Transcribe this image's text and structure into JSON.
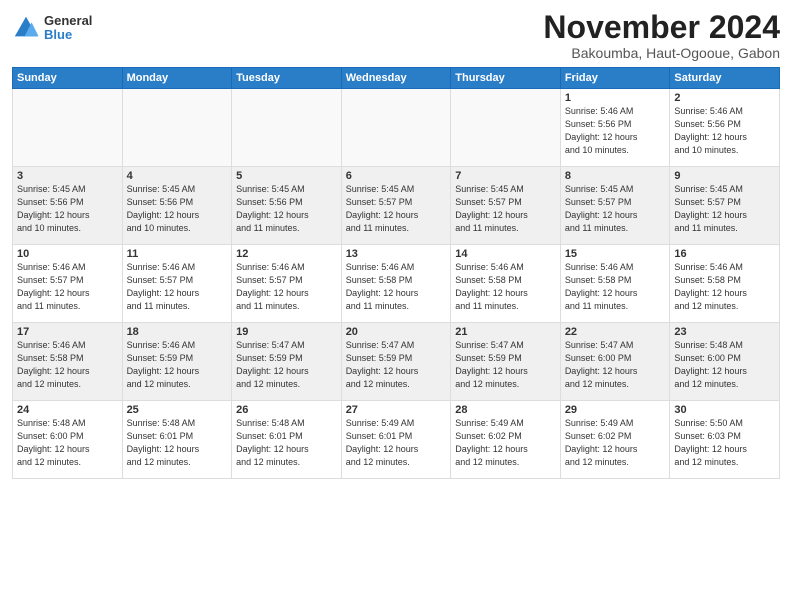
{
  "logo": {
    "general": "General",
    "blue": "Blue"
  },
  "header": {
    "month": "November 2024",
    "location": "Bakoumba, Haut-Ogooue, Gabon"
  },
  "days_of_week": [
    "Sunday",
    "Monday",
    "Tuesday",
    "Wednesday",
    "Thursday",
    "Friday",
    "Saturday"
  ],
  "weeks": [
    [
      {
        "day": "",
        "info": ""
      },
      {
        "day": "",
        "info": ""
      },
      {
        "day": "",
        "info": ""
      },
      {
        "day": "",
        "info": ""
      },
      {
        "day": "",
        "info": ""
      },
      {
        "day": "1",
        "info": "Sunrise: 5:46 AM\nSunset: 5:56 PM\nDaylight: 12 hours\nand 10 minutes."
      },
      {
        "day": "2",
        "info": "Sunrise: 5:46 AM\nSunset: 5:56 PM\nDaylight: 12 hours\nand 10 minutes."
      }
    ],
    [
      {
        "day": "3",
        "info": "Sunrise: 5:45 AM\nSunset: 5:56 PM\nDaylight: 12 hours\nand 10 minutes."
      },
      {
        "day": "4",
        "info": "Sunrise: 5:45 AM\nSunset: 5:56 PM\nDaylight: 12 hours\nand 10 minutes."
      },
      {
        "day": "5",
        "info": "Sunrise: 5:45 AM\nSunset: 5:56 PM\nDaylight: 12 hours\nand 11 minutes."
      },
      {
        "day": "6",
        "info": "Sunrise: 5:45 AM\nSunset: 5:57 PM\nDaylight: 12 hours\nand 11 minutes."
      },
      {
        "day": "7",
        "info": "Sunrise: 5:45 AM\nSunset: 5:57 PM\nDaylight: 12 hours\nand 11 minutes."
      },
      {
        "day": "8",
        "info": "Sunrise: 5:45 AM\nSunset: 5:57 PM\nDaylight: 12 hours\nand 11 minutes."
      },
      {
        "day": "9",
        "info": "Sunrise: 5:45 AM\nSunset: 5:57 PM\nDaylight: 12 hours\nand 11 minutes."
      }
    ],
    [
      {
        "day": "10",
        "info": "Sunrise: 5:46 AM\nSunset: 5:57 PM\nDaylight: 12 hours\nand 11 minutes."
      },
      {
        "day": "11",
        "info": "Sunrise: 5:46 AM\nSunset: 5:57 PM\nDaylight: 12 hours\nand 11 minutes."
      },
      {
        "day": "12",
        "info": "Sunrise: 5:46 AM\nSunset: 5:57 PM\nDaylight: 12 hours\nand 11 minutes."
      },
      {
        "day": "13",
        "info": "Sunrise: 5:46 AM\nSunset: 5:58 PM\nDaylight: 12 hours\nand 11 minutes."
      },
      {
        "day": "14",
        "info": "Sunrise: 5:46 AM\nSunset: 5:58 PM\nDaylight: 12 hours\nand 11 minutes."
      },
      {
        "day": "15",
        "info": "Sunrise: 5:46 AM\nSunset: 5:58 PM\nDaylight: 12 hours\nand 11 minutes."
      },
      {
        "day": "16",
        "info": "Sunrise: 5:46 AM\nSunset: 5:58 PM\nDaylight: 12 hours\nand 12 minutes."
      }
    ],
    [
      {
        "day": "17",
        "info": "Sunrise: 5:46 AM\nSunset: 5:58 PM\nDaylight: 12 hours\nand 12 minutes."
      },
      {
        "day": "18",
        "info": "Sunrise: 5:46 AM\nSunset: 5:59 PM\nDaylight: 12 hours\nand 12 minutes."
      },
      {
        "day": "19",
        "info": "Sunrise: 5:47 AM\nSunset: 5:59 PM\nDaylight: 12 hours\nand 12 minutes."
      },
      {
        "day": "20",
        "info": "Sunrise: 5:47 AM\nSunset: 5:59 PM\nDaylight: 12 hours\nand 12 minutes."
      },
      {
        "day": "21",
        "info": "Sunrise: 5:47 AM\nSunset: 5:59 PM\nDaylight: 12 hours\nand 12 minutes."
      },
      {
        "day": "22",
        "info": "Sunrise: 5:47 AM\nSunset: 6:00 PM\nDaylight: 12 hours\nand 12 minutes."
      },
      {
        "day": "23",
        "info": "Sunrise: 5:48 AM\nSunset: 6:00 PM\nDaylight: 12 hours\nand 12 minutes."
      }
    ],
    [
      {
        "day": "24",
        "info": "Sunrise: 5:48 AM\nSunset: 6:00 PM\nDaylight: 12 hours\nand 12 minutes."
      },
      {
        "day": "25",
        "info": "Sunrise: 5:48 AM\nSunset: 6:01 PM\nDaylight: 12 hours\nand 12 minutes."
      },
      {
        "day": "26",
        "info": "Sunrise: 5:48 AM\nSunset: 6:01 PM\nDaylight: 12 hours\nand 12 minutes."
      },
      {
        "day": "27",
        "info": "Sunrise: 5:49 AM\nSunset: 6:01 PM\nDaylight: 12 hours\nand 12 minutes."
      },
      {
        "day": "28",
        "info": "Sunrise: 5:49 AM\nSunset: 6:02 PM\nDaylight: 12 hours\nand 12 minutes."
      },
      {
        "day": "29",
        "info": "Sunrise: 5:49 AM\nSunset: 6:02 PM\nDaylight: 12 hours\nand 12 minutes."
      },
      {
        "day": "30",
        "info": "Sunrise: 5:50 AM\nSunset: 6:03 PM\nDaylight: 12 hours\nand 12 minutes."
      }
    ]
  ]
}
